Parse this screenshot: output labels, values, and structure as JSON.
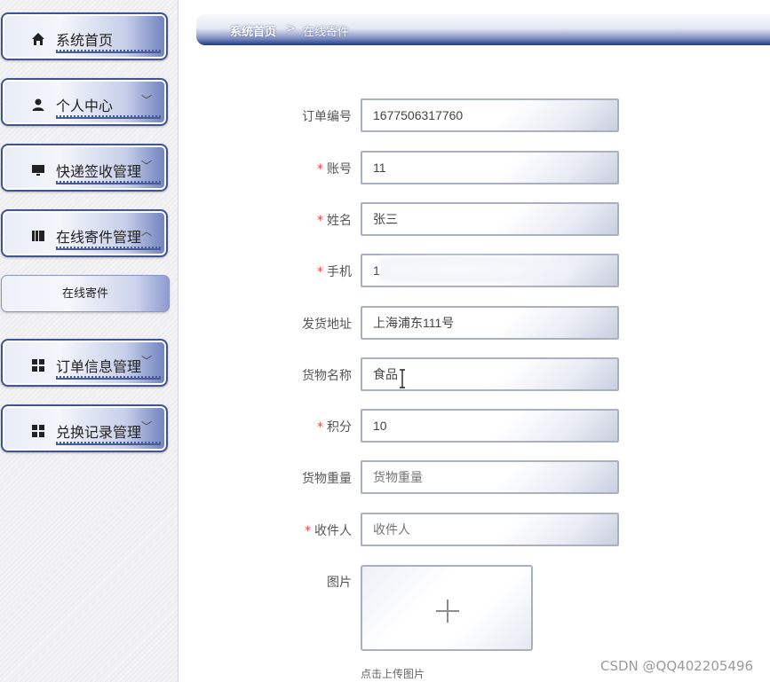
{
  "sidebar": {
    "items": [
      {
        "label": "系统首页",
        "icon": "home-icon",
        "chevron": ""
      },
      {
        "label": "个人中心",
        "icon": "user-icon",
        "chevron": "﹀"
      },
      {
        "label": "快递签收管理",
        "icon": "monitor-icon",
        "chevron": "﹀"
      },
      {
        "label": "在线寄件管理",
        "icon": "book-icon",
        "chevron": "︿"
      },
      {
        "label": "订单信息管理",
        "icon": "grid-icon",
        "chevron": "﹀"
      },
      {
        "label": "兑换记录管理",
        "icon": "grid-icon",
        "chevron": "﹀"
      }
    ],
    "subitem": {
      "label": "在线寄件"
    }
  },
  "breadcrumb": {
    "home": "系统首页",
    "separator": ">",
    "current": "在线寄件"
  },
  "form": {
    "order_no": {
      "label": "订单编号",
      "value": "1677506317760",
      "required": false
    },
    "account": {
      "label": "账号",
      "value": "11",
      "required": true
    },
    "name": {
      "label": "姓名",
      "value": "张三",
      "required": true
    },
    "phone": {
      "label": "手机",
      "value": "1",
      "required": true
    },
    "address": {
      "label": "发货地址",
      "value": "上海浦东111号",
      "required": false
    },
    "goods_name": {
      "label": "货物名称",
      "value": "食品",
      "required": false
    },
    "points": {
      "label": "积分",
      "value": "10",
      "required": true
    },
    "weight": {
      "label": "货物重量",
      "value": "",
      "placeholder": "货物重量",
      "required": false
    },
    "receiver": {
      "label": "收件人",
      "value": "",
      "placeholder": "收件人",
      "required": true
    },
    "image": {
      "label": "图片",
      "hint": "点击上传图片"
    }
  },
  "required_mark": "*",
  "watermark": "CSDN @QQ402205496",
  "colors": {
    "accent": "#1e3a86",
    "border": "#3e5494",
    "required": "#e5484d"
  }
}
